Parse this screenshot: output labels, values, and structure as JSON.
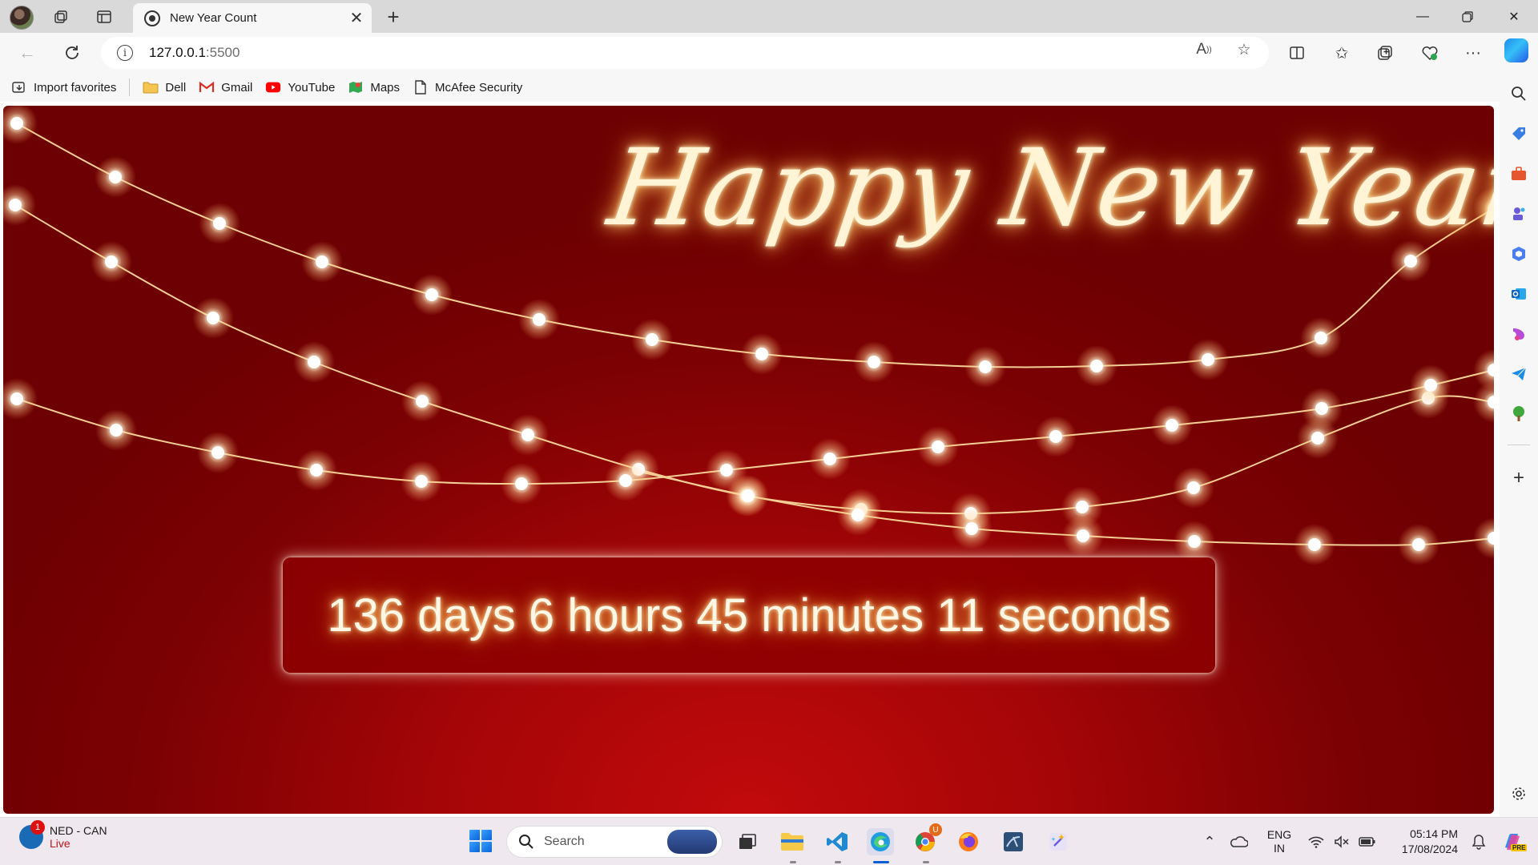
{
  "browser": {
    "tab_title": "New Year Count",
    "url_host": "127.0.0.1",
    "url_port": ":5500"
  },
  "favorites": [
    {
      "label": "Import favorites",
      "icon": "import-favorites-icon"
    },
    {
      "label": "Dell",
      "icon": "folder-icon"
    },
    {
      "label": "Gmail",
      "icon": "gmail-icon"
    },
    {
      "label": "YouTube",
      "icon": "youtube-icon"
    },
    {
      "label": "Maps",
      "icon": "maps-icon"
    },
    {
      "label": "McAfee Security",
      "icon": "page-icon"
    }
  ],
  "page": {
    "headline": "Happy New Year",
    "countdown": "136 days 6 hours 45 minutes 11 seconds",
    "colors": {
      "background": "#8a0204",
      "glow": "#ffc868",
      "text": "#fff7e6"
    }
  },
  "taskbar": {
    "widget_title": "NED - CAN",
    "widget_status": "Live",
    "widget_badge": "1",
    "search_placeholder": "Search",
    "chrome_badge": "U",
    "language_top": "ENG",
    "language_bottom": "IN",
    "time": "05:14 PM",
    "date": "17/08/2024",
    "copilot_badge": "PRE"
  }
}
